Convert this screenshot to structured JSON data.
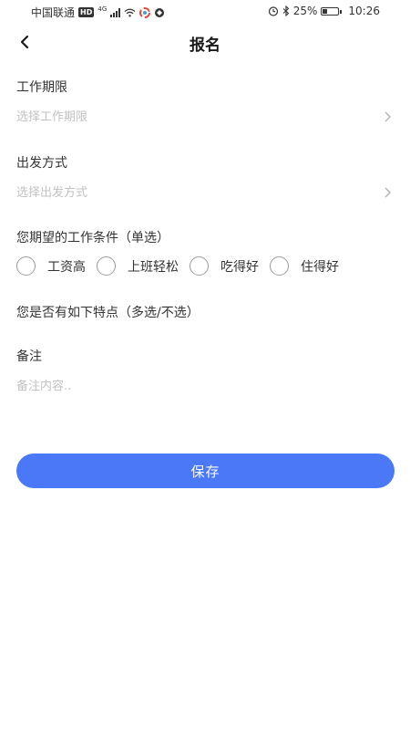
{
  "status_bar": {
    "carrier": "中国联通",
    "hd": "HD",
    "network": "4G",
    "battery": "25%",
    "battery_level": 0.25,
    "time": "10:26"
  },
  "header": {
    "title": "报名"
  },
  "form": {
    "work_period": {
      "label": "工作期限",
      "placeholder": "选择工作期限"
    },
    "departure": {
      "label": "出发方式",
      "placeholder": "选择出发方式"
    },
    "conditions": {
      "label": "您期望的工作条件（单选）",
      "options": [
        "工资高",
        "上班轻松",
        "吃得好",
        "住得好"
      ]
    },
    "features": {
      "label": "您是否有如下特点（多选/不选）"
    },
    "remark": {
      "label": "备注",
      "placeholder": "备注内容.."
    }
  },
  "save_label": "保存",
  "colors": {
    "accent": "#4a78f6",
    "placeholder": "#c2c2c2"
  }
}
